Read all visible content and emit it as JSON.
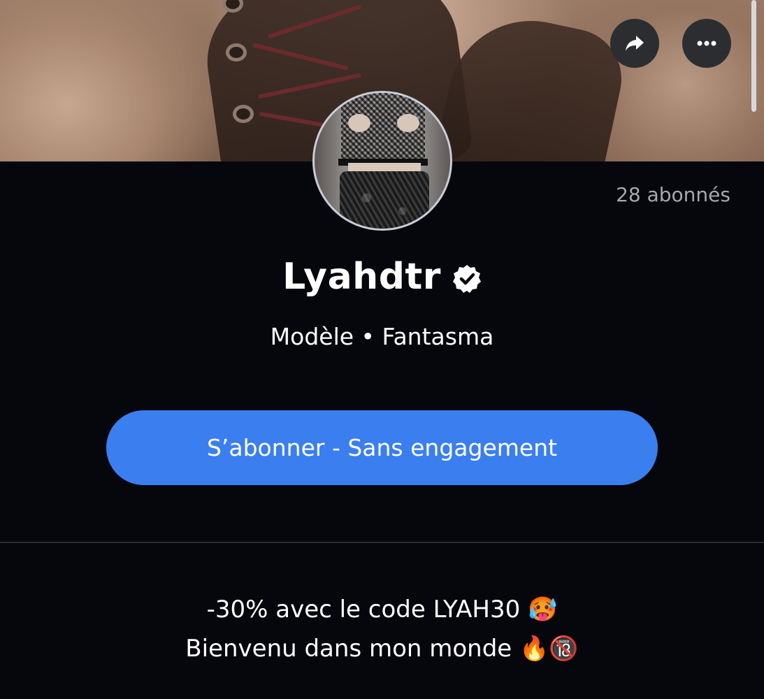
{
  "profile": {
    "followers_text": "28 abonnés",
    "name": "Lyahdtr",
    "subtitle": "Modèle • Fantasma",
    "verified_icon": "verified-badge-icon"
  },
  "actions": {
    "share_icon": "share-arrow-icon",
    "more_icon": "more-dots-icon",
    "subscribe_label": "S’abonner - Sans engagement"
  },
  "bio": {
    "line1": "-30% avec le code LYAH30 🥵",
    "line2": "Bienvenu dans mon monde 🔥🔞"
  },
  "colors": {
    "background": "#05070c",
    "accent": "#3b7ef0",
    "icon_button": "#2b2d31",
    "muted_text": "#a6a8ad"
  }
}
